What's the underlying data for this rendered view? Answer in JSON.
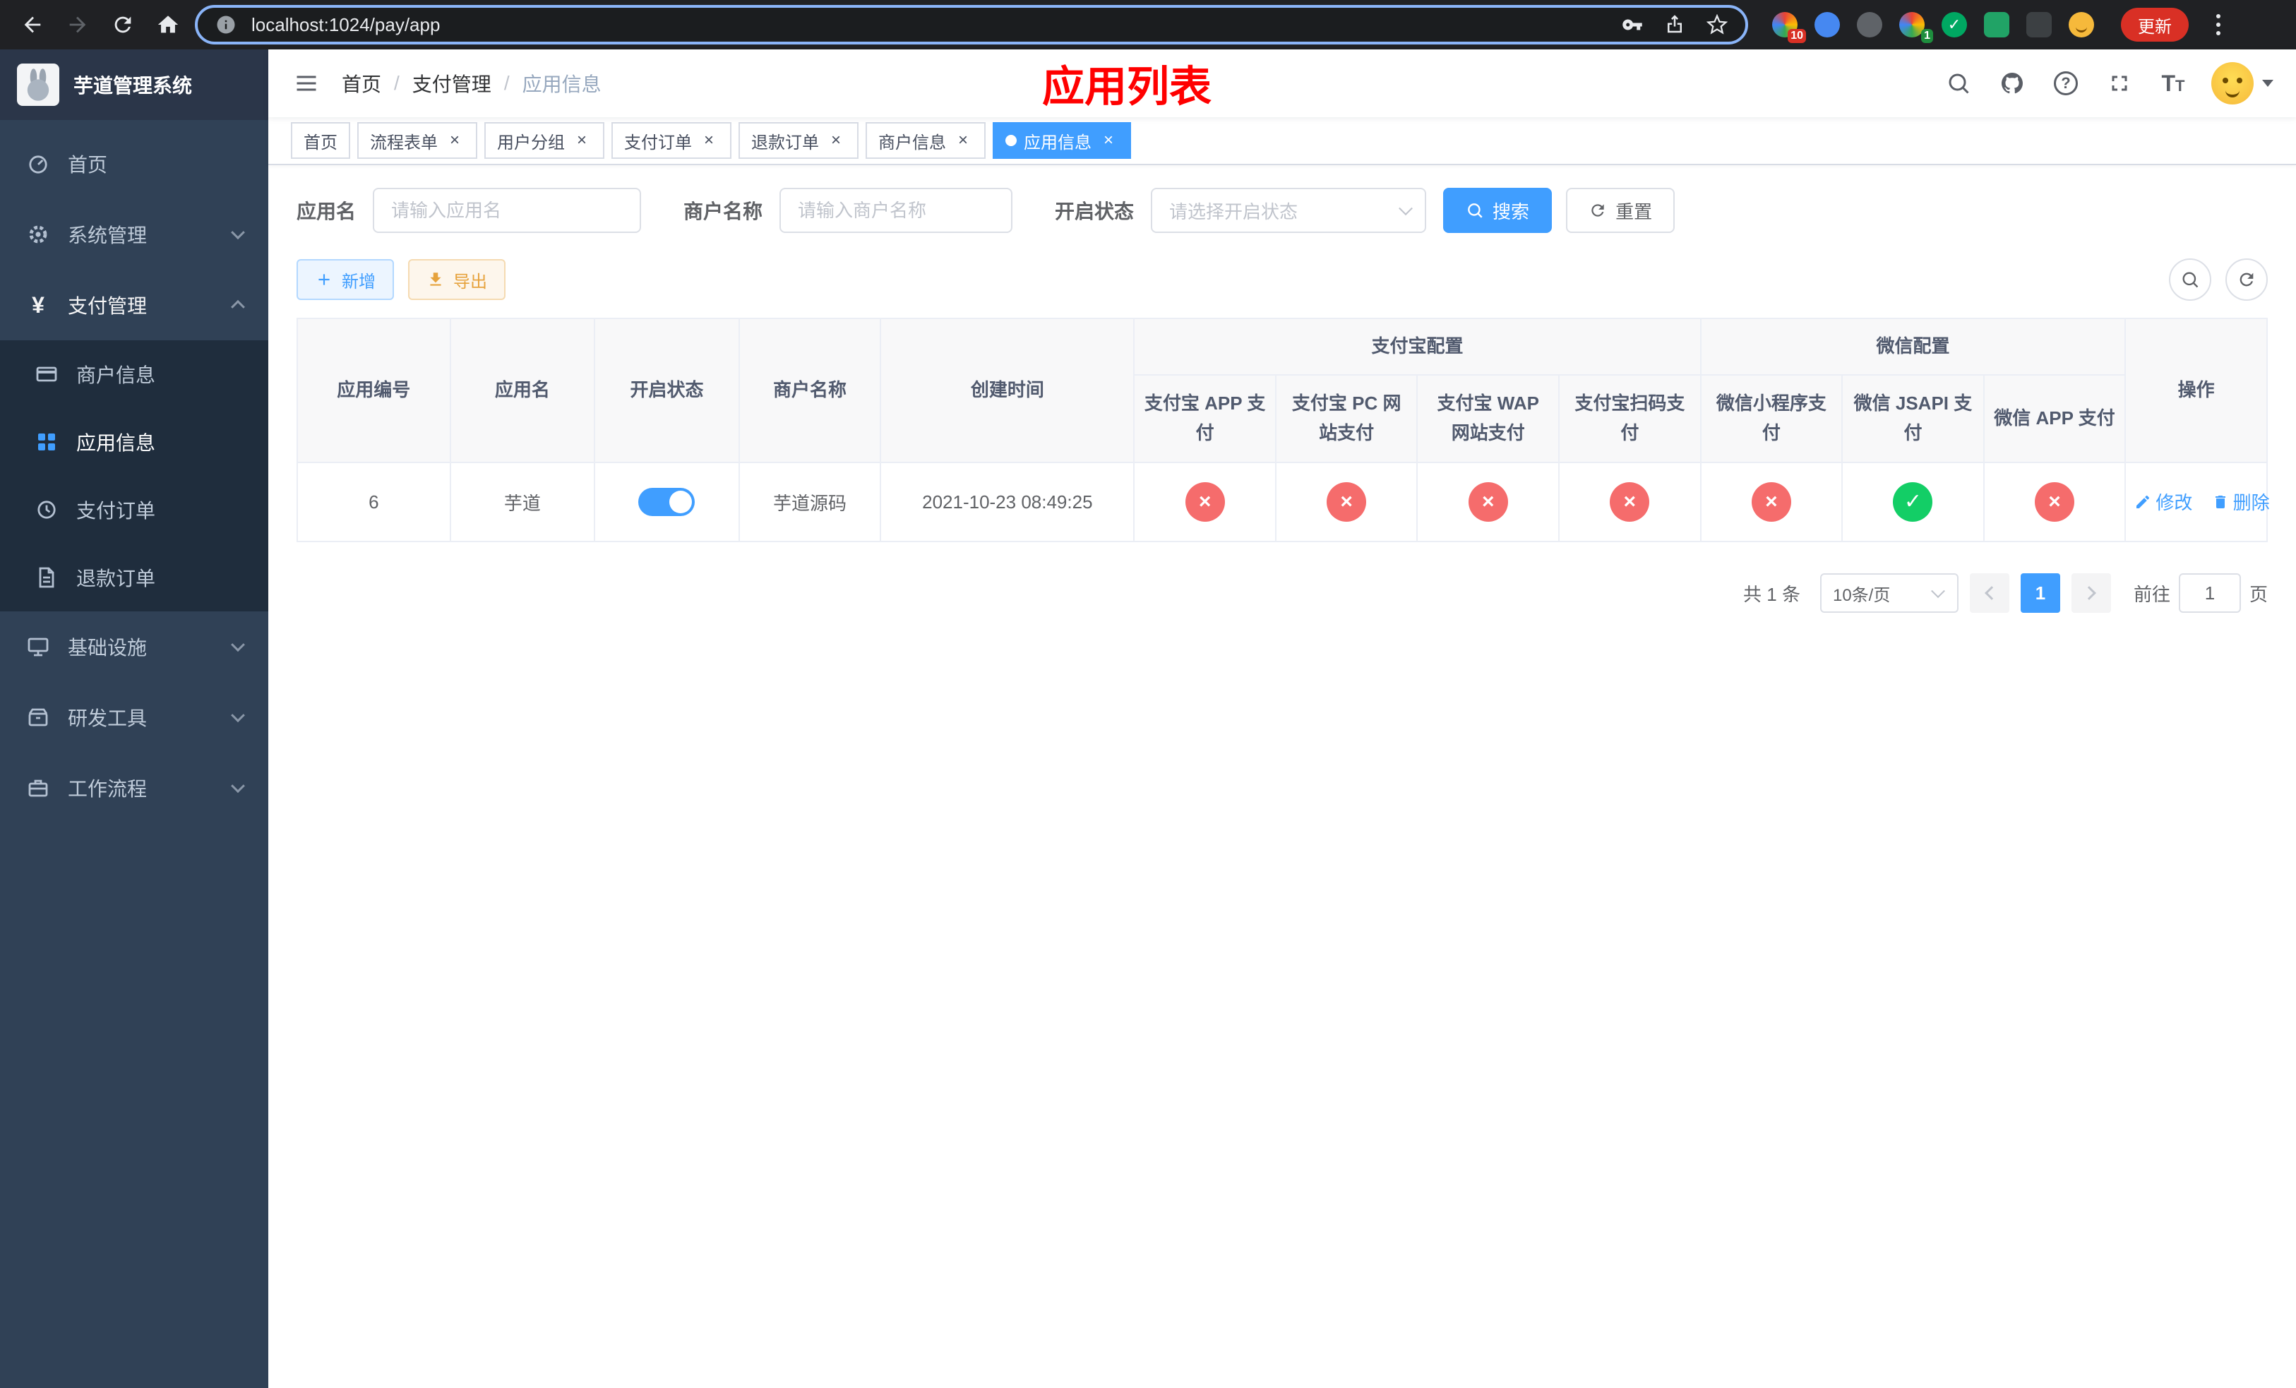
{
  "colors": {
    "primary": "#409eff",
    "success": "#13ce66",
    "danger": "#f56c6c",
    "warning": "#e6a23c",
    "annotation": "#ff0000",
    "sidebar": "#304156"
  },
  "browser": {
    "url": "localhost:1024/pay/app",
    "update_label": "更新",
    "badge_a": "10",
    "badge_b": "1"
  },
  "sidebar": {
    "title": "芋道管理系统",
    "home": "首页",
    "system": "系统管理",
    "payment": "支付管理",
    "merchant_info": "商户信息",
    "app_info": "应用信息",
    "pay_order": "支付订单",
    "refund_order": "退款订单",
    "infrastructure": "基础设施",
    "dev_tools": "研发工具",
    "workflow": "工作流程"
  },
  "breadcrumb": {
    "home": "首页",
    "section": "支付管理",
    "current": "应用信息"
  },
  "annotation": {
    "text": "应用列表"
  },
  "tabs": [
    {
      "label": "首页"
    },
    {
      "label": "流程表单"
    },
    {
      "label": "用户分组"
    },
    {
      "label": "支付订单"
    },
    {
      "label": "退款订单"
    },
    {
      "label": "商户信息"
    },
    {
      "label": "应用信息"
    }
  ],
  "filter": {
    "app_name_label": "应用名",
    "app_name_placeholder": "请输入应用名",
    "merchant_label": "商户名称",
    "merchant_placeholder": "请输入商户名称",
    "status_label": "开启状态",
    "status_placeholder": "请选择开启状态",
    "search": "搜索",
    "reset": "重置"
  },
  "toolbar": {
    "add": "新增",
    "export": "导出"
  },
  "table": {
    "col_app_id": "应用编号",
    "col_app_name": "应用名",
    "col_status": "开启状态",
    "col_merchant": "商户名称",
    "col_create_time": "创建时间",
    "group_alipay": "支付宝配置",
    "group_wechat": "微信配置",
    "col_alipay_app": "支付宝 APP 支付",
    "col_alipay_pc": "支付宝 PC 网站支付",
    "col_alipay_wap": "支付宝 WAP 网站支付",
    "col_alipay_qr": "支付宝扫码支付",
    "col_wx_mini": "微信小程序支付",
    "col_wx_jsapi": "微信 JSAPI 支付",
    "col_wx_app": "微信 APP 支付",
    "col_actions": "操作",
    "row": {
      "app_id": "6",
      "app_name": "芋道",
      "status_on": true,
      "merchant": "芋道源码",
      "create_time": "2021-10-23 08:49:25",
      "pay_config": [
        "fail",
        "fail",
        "fail",
        "fail",
        "fail",
        "success",
        "fail"
      ],
      "edit": "修改",
      "delete": "删除"
    }
  },
  "pagination": {
    "total": "共 1 条",
    "page_size": "10条/页",
    "page": "1",
    "goto": "前往",
    "goto_value": "1",
    "page_unit": "页"
  }
}
